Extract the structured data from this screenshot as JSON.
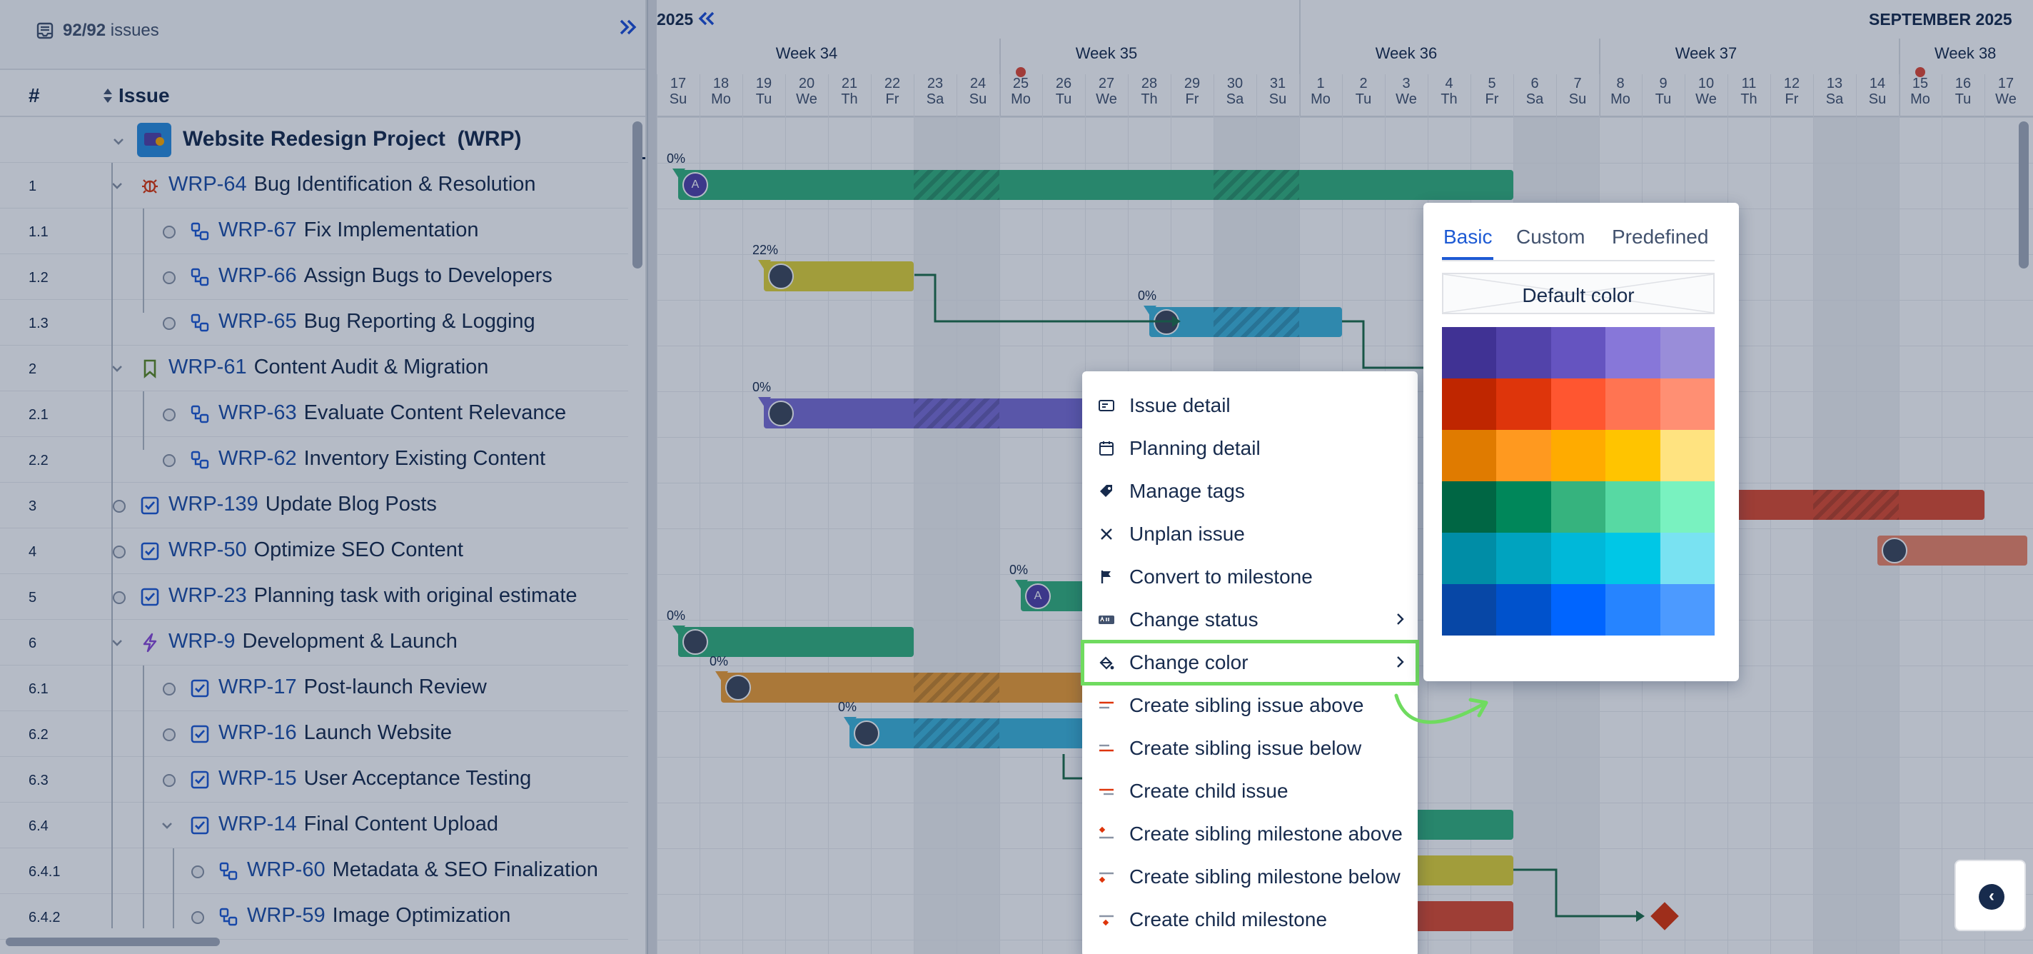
{
  "toolbar": {
    "issue_count_strong": "92/92",
    "issue_count_rest": " issues",
    "collapse_icon": "double-chevron-right-icon"
  },
  "list_header": {
    "number": "#",
    "issue": "Issue"
  },
  "project": {
    "name": "Website Redesign Project",
    "key": "(WRP)"
  },
  "rows": [
    {
      "num": "1",
      "key": "WRP-64",
      "title": "Bug Identification & Resolution",
      "type": "bug"
    },
    {
      "num": "1.1",
      "key": "WRP-67",
      "title": "Fix Implementation",
      "type": "subtask"
    },
    {
      "num": "1.2",
      "key": "WRP-66",
      "title": "Assign Bugs to Developers",
      "type": "subtask"
    },
    {
      "num": "1.3",
      "key": "WRP-65",
      "title": "Bug Reporting & Logging",
      "type": "subtask"
    },
    {
      "num": "2",
      "key": "WRP-61",
      "title": "Content Audit & Migration",
      "type": "story"
    },
    {
      "num": "2.1",
      "key": "WRP-63",
      "title": "Evaluate Content Relevance",
      "type": "subtask"
    },
    {
      "num": "2.2",
      "key": "WRP-62",
      "title": "Inventory Existing Content",
      "type": "subtask"
    },
    {
      "num": "3",
      "key": "WRP-139",
      "title": "Update Blog Posts",
      "type": "task"
    },
    {
      "num": "4",
      "key": "WRP-50",
      "title": "Optimize SEO Content",
      "type": "task"
    },
    {
      "num": "5",
      "key": "WRP-23",
      "title": "Planning task with original estimate",
      "type": "task"
    },
    {
      "num": "6",
      "key": "WRP-9",
      "title": "Development & Launch",
      "type": "epic"
    },
    {
      "num": "6.1",
      "key": "WRP-17",
      "title": "Post-launch Review",
      "type": "task"
    },
    {
      "num": "6.2",
      "key": "WRP-16",
      "title": "Launch Website",
      "type": "task"
    },
    {
      "num": "6.3",
      "key": "WRP-15",
      "title": "User Acceptance Testing",
      "type": "task"
    },
    {
      "num": "6.4",
      "key": "WRP-14",
      "title": "Final Content Upload",
      "type": "task"
    },
    {
      "num": "6.4.1",
      "key": "WRP-60",
      "title": "Metadata & SEO Finalization",
      "type": "subtask"
    },
    {
      "num": "6.4.2",
      "key": "WRP-59",
      "title": "Image Optimization",
      "type": "subtask"
    }
  ],
  "timeline": {
    "year_label": "2025",
    "month_label": "SEPTEMBER 2025",
    "weeks": [
      "Week 34",
      "Week 35",
      "Week 36",
      "Week 37",
      "Week 38"
    ],
    "days": [
      {
        "d": "17",
        "w": "Su"
      },
      {
        "d": "18",
        "w": "Mo"
      },
      {
        "d": "19",
        "w": "Tu"
      },
      {
        "d": "20",
        "w": "We"
      },
      {
        "d": "21",
        "w": "Th"
      },
      {
        "d": "22",
        "w": "Fr"
      },
      {
        "d": "23",
        "w": "Sa"
      },
      {
        "d": "24",
        "w": "Su"
      },
      {
        "d": "25",
        "w": "Mo"
      },
      {
        "d": "26",
        "w": "Tu"
      },
      {
        "d": "27",
        "w": "We"
      },
      {
        "d": "28",
        "w": "Th"
      },
      {
        "d": "29",
        "w": "Fr"
      },
      {
        "d": "30",
        "w": "Sa"
      },
      {
        "d": "31",
        "w": "Su"
      },
      {
        "d": "1",
        "w": "Mo"
      },
      {
        "d": "2",
        "w": "Tu"
      },
      {
        "d": "3",
        "w": "We"
      },
      {
        "d": "4",
        "w": "Th"
      },
      {
        "d": "5",
        "w": "Fr"
      },
      {
        "d": "6",
        "w": "Sa"
      },
      {
        "d": "7",
        "w": "Su"
      },
      {
        "d": "8",
        "w": "Mo"
      },
      {
        "d": "9",
        "w": "Tu"
      },
      {
        "d": "10",
        "w": "We"
      },
      {
        "d": "11",
        "w": "Th"
      },
      {
        "d": "12",
        "w": "Fr"
      },
      {
        "d": "13",
        "w": "Sa"
      },
      {
        "d": "14",
        "w": "Su"
      },
      {
        "d": "15",
        "w": "Mo"
      },
      {
        "d": "16",
        "w": "Tu"
      },
      {
        "d": "17",
        "w": "We"
      }
    ]
  },
  "bars": [
    {
      "row": 0,
      "start": 1,
      "end": 20,
      "color": "#36b37e",
      "pct": "0%",
      "avatar": "A"
    },
    {
      "row": 2,
      "start": 3,
      "end": 6,
      "color": "#e2d538",
      "pct": "22%",
      "avatar": ""
    },
    {
      "row": 3,
      "start": 12,
      "end": 16,
      "color": "#3fb6dc",
      "pct": "0%",
      "avatar": ""
    },
    {
      "row": 5,
      "start": 3,
      "end": 11,
      "color": "#7b6fd6",
      "pct": "0%",
      "avatar": ""
    },
    {
      "row": 7,
      "start": 25,
      "end": 31,
      "color": "#de4d31",
      "pct": "",
      "avatar": ""
    },
    {
      "row": 8,
      "start": 29,
      "end": 32,
      "color": "#f08769",
      "pct": "",
      "avatar": ""
    },
    {
      "row": 9,
      "start": 9,
      "end": 11,
      "color": "#36b37e",
      "pct": "0%",
      "avatar": "A"
    },
    {
      "row": 10,
      "start": 1,
      "end": 6,
      "color": "#36b37e",
      "pct": "0%",
      "avatar": ""
    },
    {
      "row": 11,
      "start": 2,
      "end": 11,
      "color": "#f0a035",
      "pct": "0%",
      "avatar": ""
    },
    {
      "row": 12,
      "start": 5,
      "end": 11,
      "color": "#3fb6dc",
      "pct": "0%",
      "avatar": ""
    },
    {
      "row": 14,
      "start": 15,
      "end": 20,
      "color": "#36b37e",
      "pct": "",
      "avatar": ""
    },
    {
      "row": 15,
      "start": 15,
      "end": 20,
      "color": "#e2d538",
      "pct": "",
      "avatar": ""
    },
    {
      "row": 16,
      "start": 15,
      "end": 20,
      "color": "#de4d31",
      "pct": "",
      "avatar": ""
    }
  ],
  "context_menu": {
    "items": [
      {
        "label": "Issue detail",
        "icon": "detail-icon",
        "submenu": false
      },
      {
        "label": "Planning detail",
        "icon": "calendar-icon",
        "submenu": false
      },
      {
        "label": "Manage tags",
        "icon": "tag-icon",
        "submenu": false
      },
      {
        "label": "Unplan issue",
        "icon": "close-icon",
        "submenu": false
      },
      {
        "label": "Convert to milestone",
        "icon": "flag-icon",
        "submenu": false
      },
      {
        "label": "Change status",
        "icon": "status-icon",
        "submenu": true
      },
      {
        "label": "Change color",
        "icon": "paint-bucket-icon",
        "submenu": true
      },
      {
        "label": "Create sibling issue above",
        "icon": "sibling-above-icon",
        "submenu": false
      },
      {
        "label": "Create sibling issue below",
        "icon": "sibling-below-icon",
        "submenu": false
      },
      {
        "label": "Create child issue",
        "icon": "child-issue-icon",
        "submenu": false
      },
      {
        "label": "Create sibling milestone above",
        "icon": "milestone-above-icon",
        "submenu": false
      },
      {
        "label": "Create sibling milestone below",
        "icon": "milestone-below-icon",
        "submenu": false
      },
      {
        "label": "Create child milestone",
        "icon": "child-milestone-icon",
        "submenu": false
      }
    ]
  },
  "color_picker": {
    "tabs": [
      "Basic",
      "Custom",
      "Predefined"
    ],
    "active_tab": "Basic",
    "default_label": "Default color",
    "swatches": [
      [
        "#403294",
        "#5243aa",
        "#6554c0",
        "#8777d9",
        "#998dd9"
      ],
      [
        "#bf2600",
        "#de350b",
        "#ff5630",
        "#ff7452",
        "#ff8f73"
      ],
      [
        "#e07b00",
        "#ff991f",
        "#ffab00",
        "#ffc400",
        "#ffe380"
      ],
      [
        "#006644",
        "#00875a",
        "#36b37e",
        "#57d9a3",
        "#79f2c0"
      ],
      [
        "#008da6",
        "#00a3bf",
        "#00b8d9",
        "#00c7e6",
        "#79e2f2"
      ],
      [
        "#0747a6",
        "#0052cc",
        "#0065ff",
        "#2684ff",
        "#4c9aff"
      ]
    ]
  },
  "colors": {
    "accent": "#1d5ad4",
    "highlight": "#6fdb5f",
    "link": "#1d4fa8"
  }
}
